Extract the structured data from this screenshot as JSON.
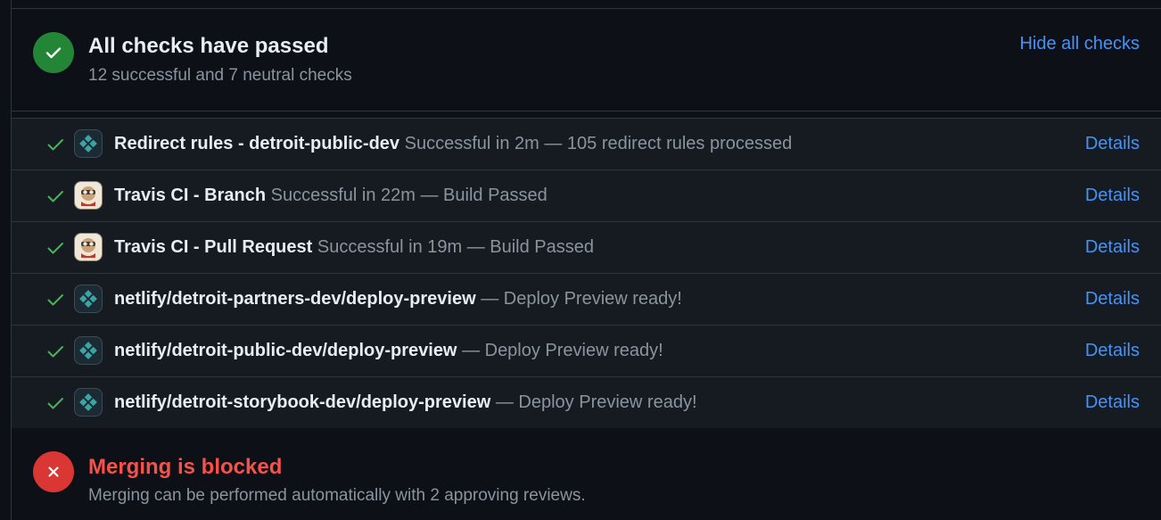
{
  "header": {
    "title": "All checks have passed",
    "subtitle": "12 successful and 7 neutral checks",
    "hide_link": "Hide all checks",
    "icon": "check-circle-icon",
    "color": "#238636"
  },
  "checks": [
    {
      "name": "Redirect rules - detroit-public-dev",
      "description": "Successful in 2m — 105 redirect rules processed",
      "app": "netlify-icon",
      "details": "Details"
    },
    {
      "name": "Travis CI - Branch",
      "description": "Successful in 22m — Build Passed",
      "app": "travis-ci-icon",
      "details": "Details"
    },
    {
      "name": "Travis CI - Pull Request",
      "description": "Successful in 19m — Build Passed",
      "app": "travis-ci-icon",
      "details": "Details"
    },
    {
      "name": "netlify/detroit-partners-dev/deploy-preview",
      "description": "— Deploy Preview ready!",
      "app": "netlify-icon",
      "details": "Details"
    },
    {
      "name": "netlify/detroit-public-dev/deploy-preview",
      "description": "— Deploy Preview ready!",
      "app": "netlify-icon",
      "details": "Details"
    },
    {
      "name": "netlify/detroit-storybook-dev/deploy-preview",
      "description": "— Deploy Preview ready!",
      "app": "netlify-icon",
      "details": "Details"
    }
  ],
  "merge": {
    "title": "Merging is blocked",
    "subtitle": "Merging can be performed automatically with 2 approving reviews.",
    "icon": "x-circle-icon",
    "color": "#da3633"
  },
  "colors": {
    "background": "#0d1117",
    "success": "#238636",
    "danger": "#f85149",
    "link": "#4493f8",
    "muted": "#8b949e"
  }
}
